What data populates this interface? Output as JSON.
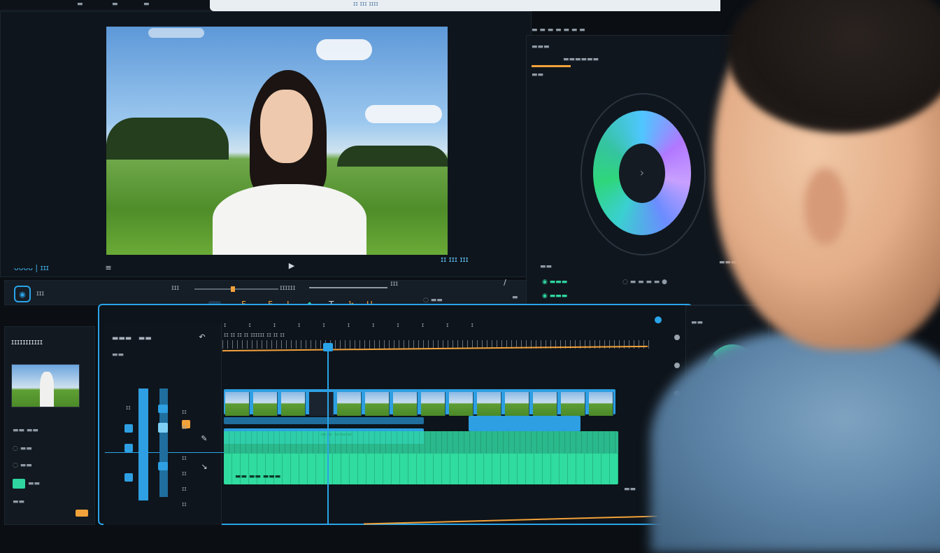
{
  "app": {
    "title_partial": "ɪɪ ɪɪɪ ɪɪɪɪ"
  },
  "preview": {
    "left_controls": "ᴗᴗᴗᴗ | ɪɪɪ",
    "right_controls": "ɪɪ  ɪɪɪ ɪɪɪ"
  },
  "transport": {
    "clip_label": "ɪɪɪ",
    "time_left": "ɪɪɪ",
    "time_mid": "ɪɪɪɪɪɪ",
    "time_right": "ɪɪɪ"
  },
  "media_panel": {
    "title": "ɪɪɪɪɪɪɪɪɪɪɪ"
  },
  "colors": {
    "accent_blue": "#2d9fe2",
    "accent_green": "#2fd6a0",
    "playhead": "#2aa4e8",
    "marker_orange": "#f2a23a",
    "marker_purple": "#b06cff"
  },
  "icons": {
    "play": "play-icon",
    "wheel_arrow": "chevron-right-icon"
  }
}
